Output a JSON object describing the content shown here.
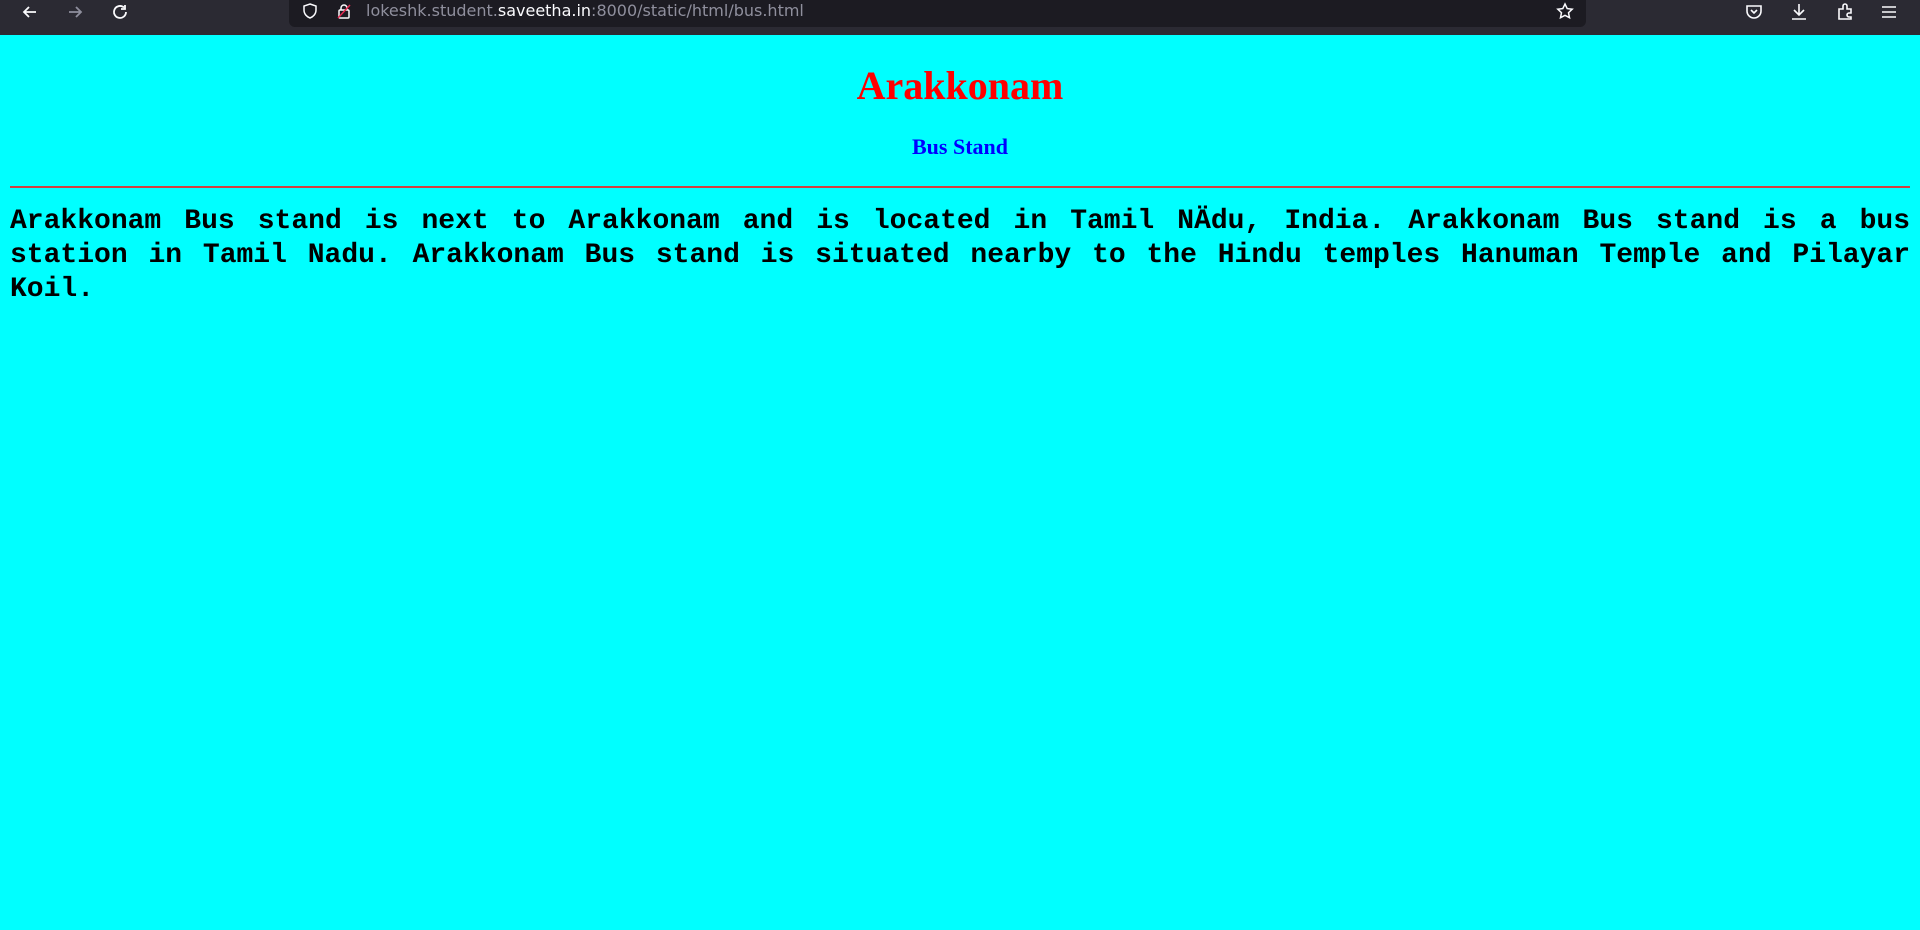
{
  "browser": {
    "url_prefix": "lokeshk.student.",
    "url_host": "saveetha.in",
    "url_suffix": ":8000/static/html/bus.html",
    "icons": [
      "back-icon",
      "forward-icon",
      "reload-icon",
      "shield-icon",
      "lock-icon",
      "star-icon",
      "pocket-icon",
      "download-icon",
      "extensions-icon",
      "menu-icon"
    ]
  },
  "page": {
    "title": "Arakkonam",
    "subtitle": "Bus Stand",
    "paragraph": "Arakkonam Bus stand is next to Arakkonam and is located in Tamil NÄdu, India. Arakkonam Bus stand is a bus station in Tamil Nadu. Arakkonam Bus stand is situated nearby to the Hindu temples Hanuman Temple and Pilayar Koil."
  },
  "colors": {
    "background": "#00ffff",
    "title": "#ff0000",
    "subtitle": "#0000ff",
    "divider": "#d04040",
    "text": "#000000"
  }
}
